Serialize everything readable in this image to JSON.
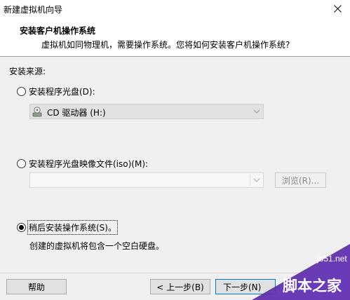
{
  "window": {
    "title": "新建虚拟机向导"
  },
  "header": {
    "title": "安装客户机操作系统",
    "subtitle": "虚拟机如同物理机，需要操作系统。您将如何安装客户机操作系统?"
  },
  "install_source": {
    "label": "安装来源:",
    "options": [
      {
        "label": "安装程序光盘(D):",
        "selected": false
      },
      {
        "label": "安装程序光盘映像文件(iso)(M):",
        "selected": false
      },
      {
        "label": "稍后安装操作系统(S)。",
        "selected": true
      }
    ],
    "drive_select": {
      "value": "CD 驱动器 (H:)",
      "icon": "cd-drive-icon"
    },
    "iso_select": {
      "value": ""
    },
    "browse_button": "浏览(R)...",
    "later_description": "创建的虚拟机将包含一个空白硬盘。"
  },
  "footer": {
    "help_button": "帮助",
    "back_button": "< 上一步(B)",
    "next_button": "下一步(N)"
  },
  "watermark": {
    "url": "jb51.net",
    "name": "脚本之家"
  },
  "colors": {
    "accent": "#0078d7",
    "watermark": "#5b2ea6"
  }
}
